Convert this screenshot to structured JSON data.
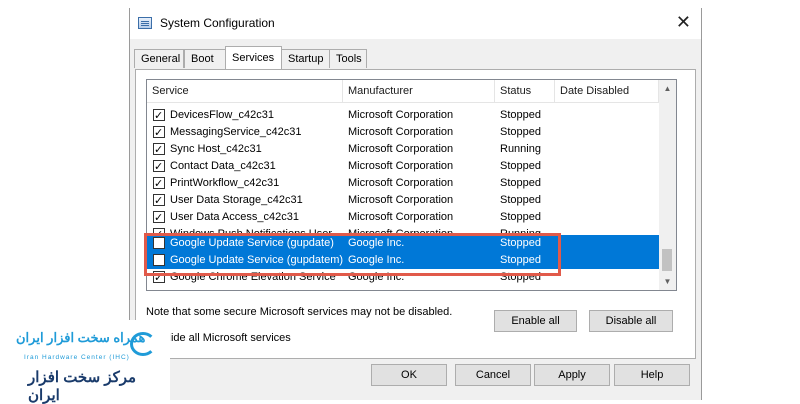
{
  "window": {
    "title": "System Configuration",
    "close_glyph": "✕"
  },
  "tabs": [
    "General",
    "Boot",
    "Services",
    "Startup",
    "Tools"
  ],
  "active_tab": "Services",
  "list": {
    "columns": [
      "Service",
      "Manufacturer",
      "Status",
      "Date Disabled"
    ],
    "rows": [
      {
        "checked": true,
        "service": "DevicesFlow_c42c31",
        "manufacturer": "Microsoft Corporation",
        "status": "Stopped",
        "selected": false
      },
      {
        "checked": true,
        "service": "MessagingService_c42c31",
        "manufacturer": "Microsoft Corporation",
        "status": "Stopped",
        "selected": false
      },
      {
        "checked": true,
        "service": "Sync Host_c42c31",
        "manufacturer": "Microsoft Corporation",
        "status": "Running",
        "selected": false
      },
      {
        "checked": true,
        "service": "Contact Data_c42c31",
        "manufacturer": "Microsoft Corporation",
        "status": "Stopped",
        "selected": false
      },
      {
        "checked": true,
        "service": "PrintWorkflow_c42c31",
        "manufacturer": "Microsoft Corporation",
        "status": "Stopped",
        "selected": false
      },
      {
        "checked": true,
        "service": "User Data Storage_c42c31",
        "manufacturer": "Microsoft Corporation",
        "status": "Stopped",
        "selected": false
      },
      {
        "checked": true,
        "service": "User Data Access_c42c31",
        "manufacturer": "Microsoft Corporation",
        "status": "Stopped",
        "selected": false
      },
      {
        "checked": true,
        "service": "Windows Push Notifications User",
        "manufacturer": "Microsoft Corporation",
        "status": "Running",
        "selected": false,
        "clipped": true
      },
      {
        "checked": false,
        "service": "Google Update Service (gupdate)",
        "manufacturer": "Google Inc.",
        "status": "Stopped",
        "selected": true
      },
      {
        "checked": false,
        "service": "Google Update Service (gupdatem)",
        "manufacturer": "Google Inc.",
        "status": "Stopped",
        "selected": true
      },
      {
        "checked": true,
        "service": "Google Chrome Elevation Service",
        "manufacturer": "Google Inc.",
        "status": "Stopped",
        "selected": false
      }
    ]
  },
  "note": "Note that some secure Microsoft services may not be disabled.",
  "buttons": {
    "enable_all": "Enable all",
    "disable_all": "Disable all",
    "ok": "OK",
    "cancel": "Cancel",
    "apply": "Apply",
    "help": "Help"
  },
  "hide_ms": {
    "label": "Hide all Microsoft services",
    "checked": false
  },
  "logo": {
    "persian_top": "همراه سخت افزار ایران",
    "english": "Iran Hardware Center (IHC)",
    "persian_bottom": "مرکز سخت افزار ایران"
  },
  "colors": {
    "selection": "#0078d7",
    "highlight_box": "#e15a4a",
    "logo_blue": "#1f9bd8"
  }
}
